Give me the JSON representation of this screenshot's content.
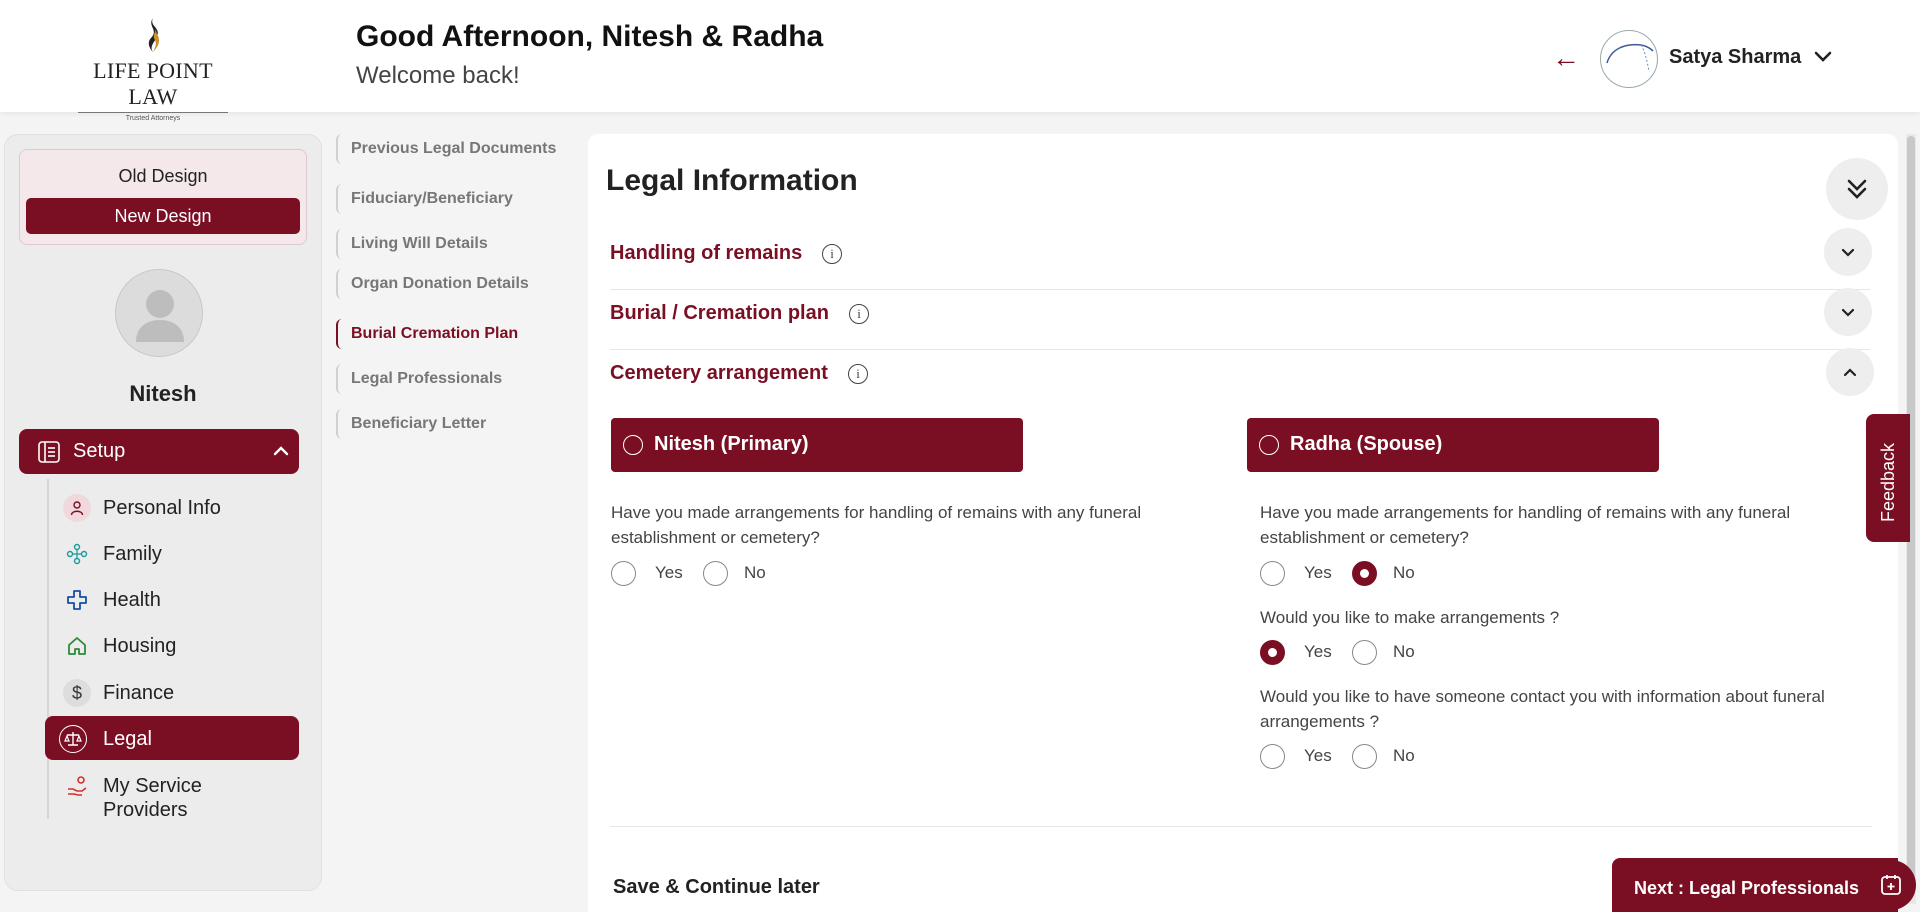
{
  "header": {
    "logo_text": "LIFE POINT LAW",
    "logo_tagline": "Trusted Attorneys",
    "greeting": "Good Afternoon, Nitesh & Radha",
    "welcome": "Welcome back!",
    "back_icon": "←",
    "user_name": "Satya Sharma"
  },
  "sidebar": {
    "old_design": "Old Design",
    "new_design": "New Design",
    "profile_name": "Nitesh",
    "setup_label": "Setup",
    "items": [
      {
        "label": "Personal Info",
        "icon": "person-icon"
      },
      {
        "label": "Family",
        "icon": "family-icon"
      },
      {
        "label": "Health",
        "icon": "health-cross-icon"
      },
      {
        "label": "Housing",
        "icon": "house-icon"
      },
      {
        "label": "Finance",
        "icon": "dollar-icon",
        "glyph": "$"
      },
      {
        "label": "Legal",
        "icon": "scales-icon",
        "active": true
      },
      {
        "label": "My Service Providers",
        "icon": "service-provider-icon"
      }
    ]
  },
  "subnav": {
    "items": [
      {
        "label": "Previous Legal Documents"
      },
      {
        "label": "Fiduciary/Beneficiary"
      },
      {
        "label": "Living Will Details"
      },
      {
        "label": "Organ Donation Details"
      },
      {
        "label": "Burial Cremation Plan",
        "active": true
      },
      {
        "label": "Legal Professionals"
      },
      {
        "label": "Beneficiary Letter"
      }
    ]
  },
  "main": {
    "title": "Legal Information",
    "info_glyph": "i",
    "sections": [
      {
        "title": "Handling of remains",
        "expanded": false
      },
      {
        "title": "Burial / Cremation plan",
        "expanded": false
      },
      {
        "title": "Cemetery arrangement",
        "expanded": true
      }
    ],
    "primary": {
      "label": "Nitesh (Primary)",
      "questions": [
        {
          "text": "Have you made arrangements for handling of remains with any funeral establishment or cemetery?",
          "selected": null
        }
      ]
    },
    "spouse": {
      "label": "Radha (Spouse)",
      "questions": [
        {
          "text": "Have you made arrangements for handling of remains with any funeral establishment or cemetery?",
          "selected": "No"
        },
        {
          "text": "Would you like to make arrangements ?",
          "selected": "Yes"
        },
        {
          "text": "Would you like to have someone contact you with information about funeral arrangements ?",
          "selected": null
        }
      ]
    },
    "yes_label": "Yes",
    "no_label": "No",
    "save_later": "Save & Continue later",
    "next_button": "Next : Legal Professionals"
  },
  "feedback_label": "Feedback",
  "colors": {
    "brand": "#7a0f24",
    "background": "#f4f4f4"
  }
}
